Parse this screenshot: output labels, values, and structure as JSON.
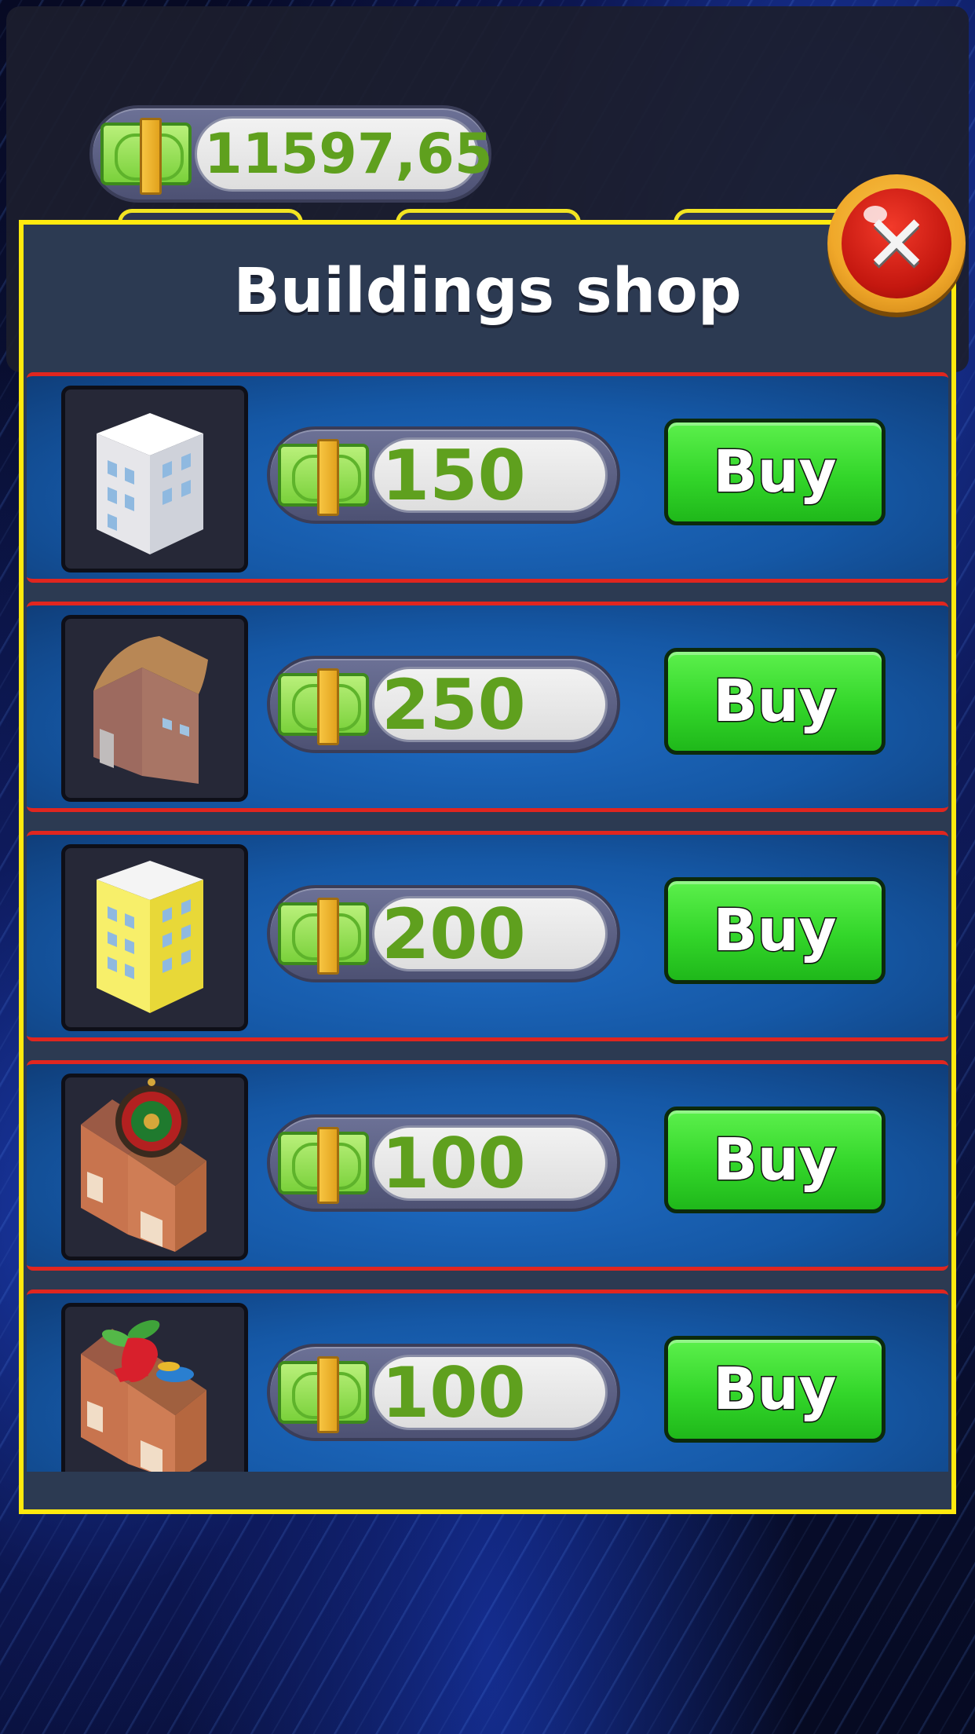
{
  "balance": "11597,65",
  "shop": {
    "title": "Buildings shop",
    "close_icon": "close-icon",
    "items": [
      {
        "building": "white-office-tower",
        "price": "150",
        "buy_label": "Buy"
      },
      {
        "building": "brown-barn-house",
        "price": "250",
        "buy_label": "Buy"
      },
      {
        "building": "yellow-apartment-tower",
        "price": "200",
        "buy_label": "Buy"
      },
      {
        "building": "casino-roulette-house",
        "price": "100",
        "buy_label": "Buy"
      },
      {
        "building": "fruit-shop-house",
        "price": "100",
        "buy_label": "Buy"
      }
    ]
  },
  "colors": {
    "frame": "#ffe90e",
    "row_border": "#e0261f",
    "buy_button": "#33d62a",
    "money_text": "#5fa01e"
  }
}
